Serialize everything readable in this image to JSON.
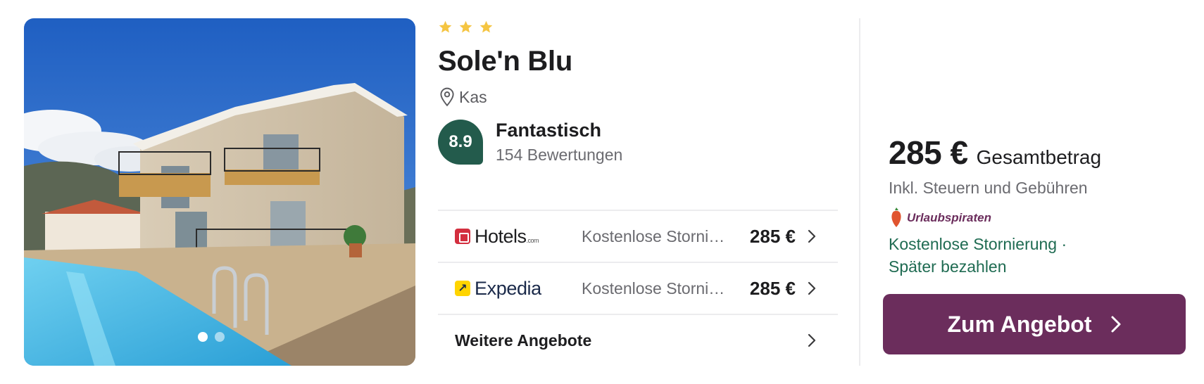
{
  "hotel": {
    "stars": 3,
    "name": "Sole'n Blu",
    "location": "Kas",
    "rating": {
      "score": "8.9",
      "label": "Fantastisch",
      "reviews": "154 Bewertungen"
    }
  },
  "gallery": {
    "image_count": 2,
    "active_index": 0
  },
  "offers": [
    {
      "provider": "Hotels",
      "provider_suffix": ".com",
      "description": "Kostenlose Stornierung",
      "price": "285 €"
    },
    {
      "provider": "Expedia",
      "description": "Kostenlose Stornierung",
      "price": "285 €"
    }
  ],
  "more_offers_label": "Weitere Angebote",
  "price_panel": {
    "price": "285 €",
    "price_label": "Gesamtbetrag",
    "price_note": "Inkl. Steuern und Gebühren",
    "partner": "Urlaubspiraten",
    "perks": "Kostenlose Stornierung ·",
    "perks_line2": "Später bezahlen",
    "cta_label": "Zum Angebot"
  },
  "colors": {
    "star": "#f5c542",
    "rating_badge": "#235b4c",
    "perks_text": "#1f6b52",
    "cta": "#6b2d5c"
  },
  "icons": [
    "star-icon",
    "location-pin-icon",
    "chevron-right-icon",
    "hotels-com-logo-icon",
    "expedia-logo-icon",
    "urlaubspiraten-logo-icon"
  ]
}
